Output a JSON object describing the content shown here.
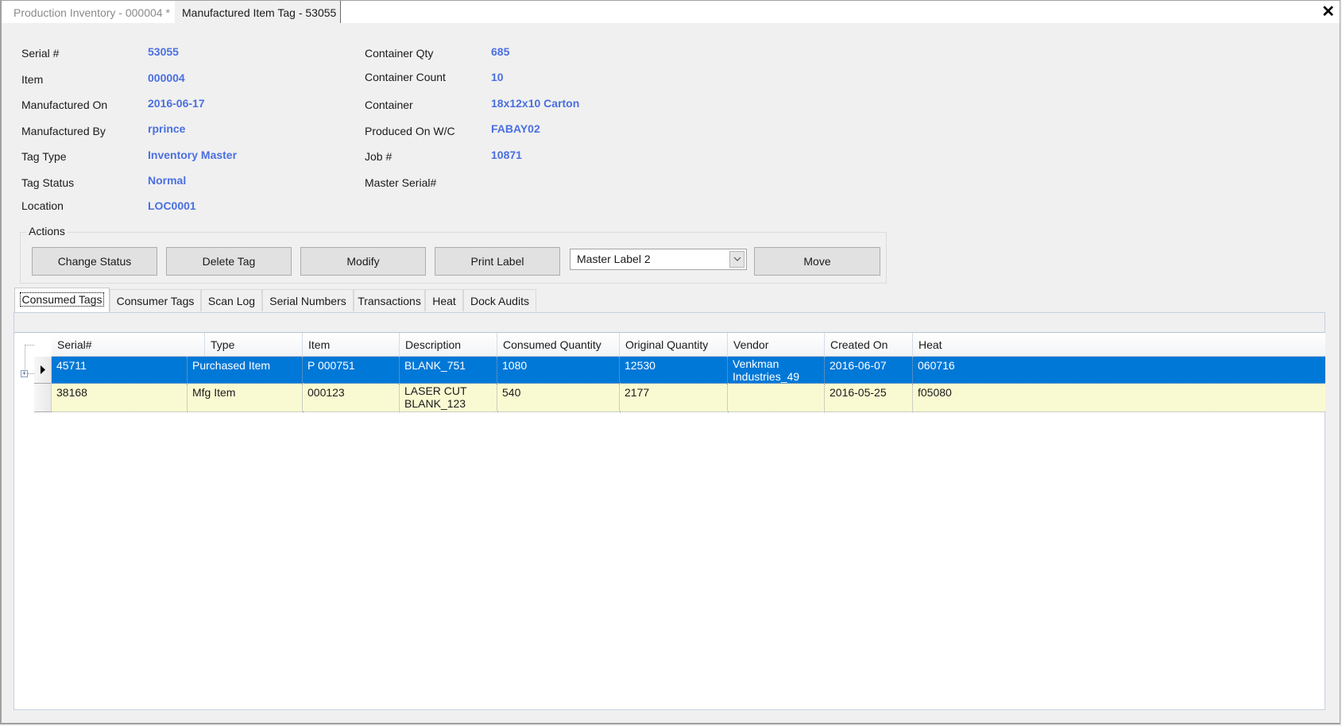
{
  "doc_tabs": [
    {
      "label": "Production Inventory - 000004 *",
      "active": false
    },
    {
      "label": "Manufactured Item Tag - 53055",
      "active": true
    }
  ],
  "close_icon": "close-icon",
  "fields_left": [
    {
      "label": "Serial #",
      "value": "53055"
    },
    {
      "label": "Item",
      "value": "000004"
    },
    {
      "label": "Manufactured On",
      "value": "2016-06-17"
    },
    {
      "label": "Manufactured By",
      "value": "rprince"
    },
    {
      "label": "Tag Type",
      "value": "Inventory Master"
    },
    {
      "label": "Tag Status",
      "value": "Normal"
    },
    {
      "label": "Location",
      "value": "LOC0001"
    }
  ],
  "fields_right": [
    {
      "label": "Container Qty",
      "value": "685"
    },
    {
      "label": "Container Count",
      "value": "10"
    },
    {
      "label": "Container",
      "value": "18x12x10 Carton"
    },
    {
      "label": "Produced On W/C",
      "value": "FABAY02"
    },
    {
      "label": "Job #",
      "value": "10871"
    },
    {
      "label": "Master Serial#",
      "value": ""
    }
  ],
  "actions": {
    "title": "Actions",
    "change_status": "Change Status",
    "delete_tag": "Delete Tag",
    "modify": "Modify",
    "print_label": "Print Label",
    "label_select": "Master Label 2",
    "move": "Move"
  },
  "tabs": [
    {
      "label": "Consumed Tags",
      "active": true
    },
    {
      "label": "Consumer Tags"
    },
    {
      "label": "Scan Log"
    },
    {
      "label": "Serial Numbers"
    },
    {
      "label": "Transactions"
    },
    {
      "label": "Heat"
    },
    {
      "label": "Dock Audits"
    }
  ],
  "grid": {
    "columns": [
      "Serial#",
      "Type",
      "Item",
      "Description",
      "Consumed Quantity",
      "Original Quantity",
      "Vendor",
      "Created On",
      "Heat"
    ],
    "rows": [
      {
        "serial": "45711",
        "type": "Purchased Item",
        "item": "P 000751",
        "description": "BLANK_751",
        "consumed": "1080",
        "original": "12530",
        "vendor": "Venkman Industries_49",
        "created": "2016-06-07",
        "heat": "060716",
        "selected": true
      },
      {
        "serial": "38168",
        "type": "Mfg Item",
        "item": "000123",
        "description": "LASER CUT BLANK_123",
        "consumed": "540",
        "original": "2177",
        "vendor": "",
        "created": "2016-05-25",
        "heat": "f05080",
        "selected": false
      }
    ]
  },
  "colors": {
    "accent_value": "#4a6fe0",
    "selection": "#0078d7",
    "alt_row": "#fafad2"
  }
}
